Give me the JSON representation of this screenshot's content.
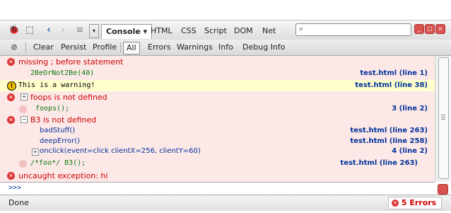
{
  "toolbar": {
    "tabs": [
      "Console",
      "HTML",
      "CSS",
      "Script",
      "DOM",
      "Net"
    ],
    "selected_tab_arrow": "▾"
  },
  "filterbar": {
    "buttons": [
      "Clear",
      "Persist",
      "Profile"
    ],
    "filters": [
      "All",
      "Errors",
      "Warnings",
      "Info",
      "Debug Info"
    ]
  },
  "log": {
    "r1": {
      "text": "missing ; before statement",
      "code": "2BeOrNot2Be(40)",
      "link": "test.html (line 1)"
    },
    "r2": {
      "text": "This is a warning!",
      "link": "test.html (line 38)"
    },
    "r3": {
      "text": "foops is not defined",
      "code": "foops();",
      "link": "3 (line 2)"
    },
    "r4": {
      "text": "B3 is not defined",
      "trace": [
        {
          "fn": "badStuff()",
          "link": "test.html (line 263)"
        },
        {
          "fn": "deepError()",
          "link": "test.html (line 258)"
        },
        {
          "fn": "onclick(event=click clientX=256, clientY=60)",
          "link": "4 (line 2)"
        }
      ],
      "code": "/*foo*/ B3();",
      "link": "test.html (line 263)"
    },
    "r5": {
      "text": "uncaught exception: hi"
    }
  },
  "cmdline": {
    "prompt": ">>>"
  },
  "status": {
    "done": "Done",
    "errors": "5 Errors"
  },
  "colors": {
    "error": "#cc0000",
    "link": "#003399",
    "code": "#0a7a0a",
    "warn_bg": "#ffffcc",
    "err_bg": "#fde8e8"
  }
}
